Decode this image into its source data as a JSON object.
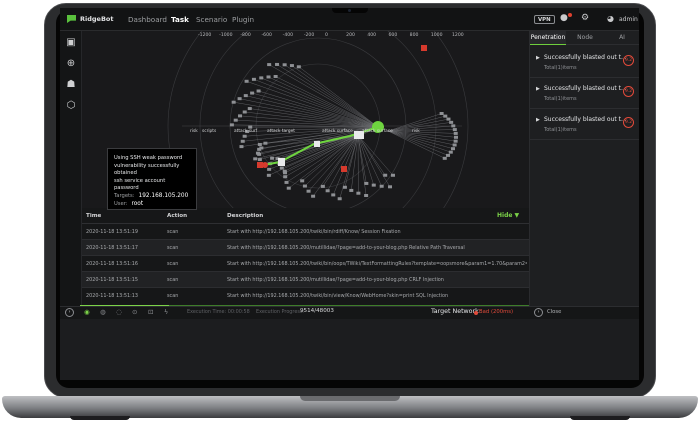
{
  "app": {
    "name": "RidgeBot"
  },
  "nav": [
    "Dashboard",
    "Task",
    "Scenario",
    "Plugin"
  ],
  "nav_active": "Task",
  "topbar": {
    "vpn": "VPN",
    "user": "admin"
  },
  "graph": {
    "scale_labels": [
      "-1200",
      "-1000",
      "-800",
      "-600",
      "-400",
      "-200",
      "0",
      "200",
      "400",
      "600",
      "800",
      "1000",
      "1200"
    ],
    "node_labels": [
      "risk",
      "scripts",
      "attack surf",
      "attack target",
      "attack surface",
      "attack surface",
      "risk"
    ]
  },
  "tooltip": {
    "lines": [
      "Using SSH weak password",
      "vulnerability successfully obtained",
      "ssh service account password"
    ],
    "target_label": "Targets:",
    "target_value": "192.168.105.200",
    "user_label": "User:",
    "user_value": "root"
  },
  "table": {
    "columns": [
      "Time",
      "Action",
      "Description"
    ],
    "hide_label": "Hide ▼",
    "rows": [
      {
        "time": "2020-11-18 13:51:19",
        "action": "scan",
        "description": "Start with http://192.168.105.200/twiki/bin/rdiff/Know/ Session Fixation"
      },
      {
        "time": "2020-11-18 13:51:17",
        "action": "scan",
        "description": "Start with http://192.168.105.200/mutillidae/?page=add-to-your-blog.php Relative Path Traversal"
      },
      {
        "time": "2020-11-18 13:51:16",
        "action": "scan",
        "description": "Start with http://192.168.105.200/twiki/bin/oops/TWiki/TextFormattingRules?template=oopsmore&param1=1.70&param2=1.7"
      },
      {
        "time": "2020-11-18 13:51:15",
        "action": "scan",
        "description": "Start with http://192.168.105.200/mutillidae/?page=add-to-your-blog.php CRLF Injection"
      },
      {
        "time": "2020-11-18 13:51:13",
        "action": "scan",
        "description": "Start with http://192.168.105.200/twiki/bin/view/Know/WebHome?skin=print SQL Injection"
      }
    ]
  },
  "statusbar": {
    "execution_time_label": "Execution Time: 00:00:58",
    "progress_label": "Execution Progress:",
    "progress_value": "9514/48003",
    "progress_fraction": 0.198,
    "target_network_label": "Target Network:",
    "target_network_status": "Bad",
    "target_network_latency": "(200ms)"
  },
  "right_panel": {
    "tabs": [
      "Penetration",
      "Node",
      "AI"
    ],
    "active_tab": "Penetration",
    "items": [
      {
        "title": "Successfully blasted out t...",
        "sub": "Total(1)items",
        "score": "9.2"
      },
      {
        "title": "Successfully blasted out t...",
        "sub": "Total(1)items",
        "score": "9.2"
      },
      {
        "title": "Successfully blasted out t...",
        "sub": "Total(1)items",
        "score": "9.2"
      }
    ],
    "close_label": "Close"
  },
  "colors": {
    "accent": "#7cd348",
    "danger": "#e14a3a",
    "background": "#1b1c1e"
  }
}
